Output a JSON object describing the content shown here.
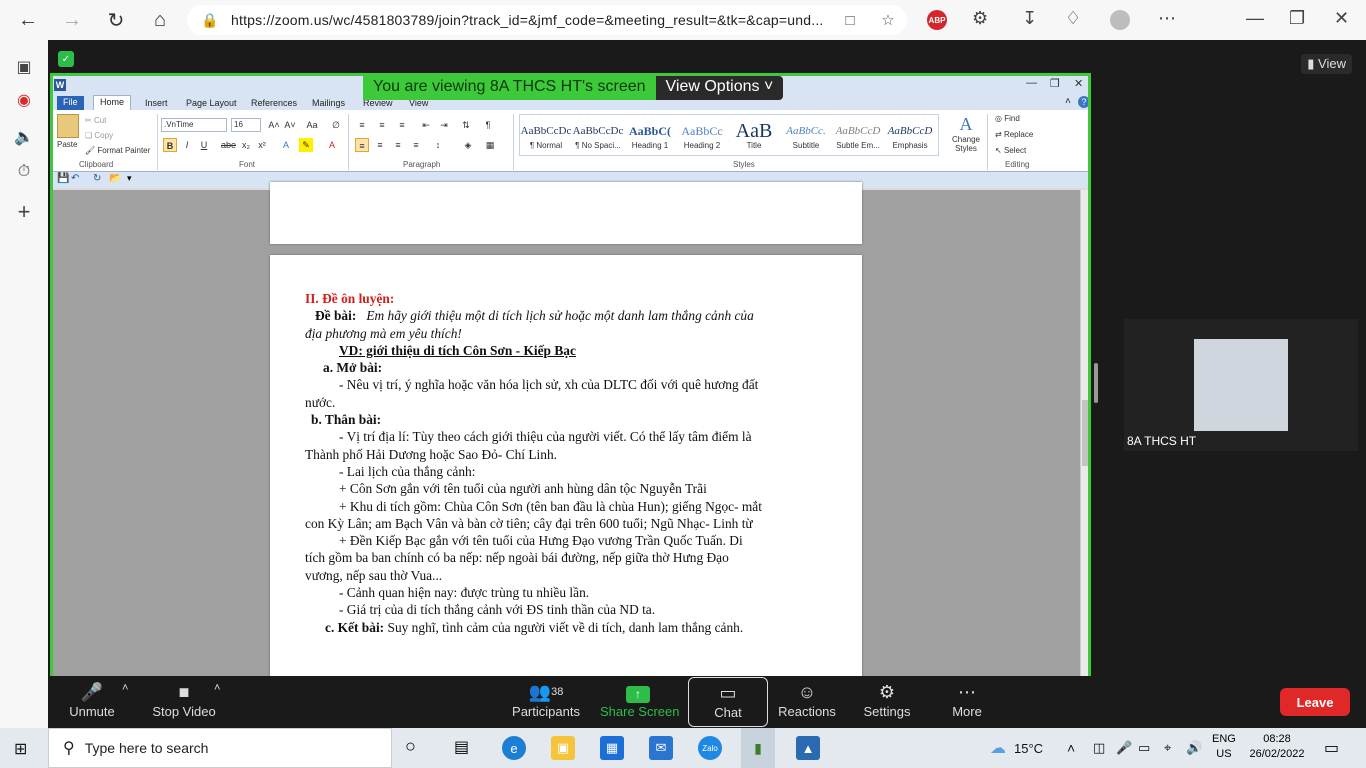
{
  "browser": {
    "url": "https://zoom.us/wc/4581803789/join?track_id=&jmf_code=&meeting_result=&tk=&cap=und...",
    "abp_label": "ABP"
  },
  "zoom": {
    "banner_text": "You are viewing 8A THCS HT's screen",
    "view_options": "View Options",
    "view_label": "View",
    "participant_name": "8A THCS HT"
  },
  "word": {
    "tabs": [
      "File",
      "Home",
      "Insert",
      "Page Layout",
      "References",
      "Mailings",
      "Review",
      "View"
    ],
    "clipboard": {
      "paste": "Paste",
      "cut": "Cut",
      "copy": "Copy",
      "format_painter": "Format Painter",
      "label": "Clipboard"
    },
    "font": {
      "name": ".VnTime",
      "size": "16",
      "label": "Font"
    },
    "paragraph_label": "Paragraph",
    "styles": [
      {
        "sample": "AaBbCcDc",
        "name": "¶ Normal"
      },
      {
        "sample": "AaBbCcDc",
        "name": "¶ No Spaci..."
      },
      {
        "sample": "AaBbC(",
        "name": "Heading 1"
      },
      {
        "sample": "AaBbCc",
        "name": "Heading 2"
      },
      {
        "sample": "AaB",
        "name": "Title"
      },
      {
        "sample": "AaBbCc.",
        "name": "Subtitle"
      },
      {
        "sample": "AaBbCcD",
        "name": "Subtle Em..."
      },
      {
        "sample": "AaBbCcD",
        "name": "Emphasis"
      }
    ],
    "styles_label": "Styles",
    "change_styles": "Change Styles",
    "editing": {
      "find": "Find",
      "replace": "Replace",
      "select": "Select",
      "label": "Editing"
    }
  },
  "document": {
    "lines": [
      "II. Đề ôn luyện:",
      "Đề bài:",
      "Em hãy giới thiệu một di tích lịch sử hoặc một danh lam thắng cảnh của",
      "địa phương mà em yêu thích!",
      "VD: giới thiệu di tích Côn Sơn - Kiếp Bạc",
      "a. Mở bài:",
      "- Nêu vị trí, ý nghĩa hoặc văn hóa lịch sử, xh của DLTC đối với quê hương đất",
      "nước.",
      "b.  Thân bài:",
      "- Vị trí địa lí: Tùy theo cách giới thiệu của người viết. Có thể lấy tâm điểm là",
      "Thành phố Hải Dương hoặc Sao Đỏ- Chí Linh.",
      "- Lai lịch của thắng cảnh:",
      "+ Côn Sơn gắn với tên tuổi của người anh hùng dân tộc Nguyễn Trãi",
      "+ Khu di tích gồm: Chùa Côn Sơn (tên ban đầu là chùa Hun); giếng Ngọc- mắt",
      "con Kỳ Lân; am Bạch Vân và bàn cờ tiên; cây đại trên 600 tuổi; Ngũ Nhạc- Linh từ",
      "+ Đền Kiếp Bạc gắn với tên tuổi của Hưng Đạo vương Trần Quốc Tuấn. Di",
      "tích gồm ba ban chính có ba nếp: nếp ngoài bái đường, nếp giữa thờ Hưng Đạo",
      "vương, nếp sau thờ Vua...",
      "- Cảnh quan hiện nay: được trùng tu nhiều lần.",
      "- Giá trị của di tích thắng cảnh với ĐS tinh thần của ND ta.",
      "c. Kết bài:",
      "Suy nghĩ, tình cảm của người viết về di tích, danh lam thắng cảnh."
    ]
  },
  "toolbar": {
    "unmute": "Unmute",
    "stop_video": "Stop Video",
    "participants": "Participants",
    "participants_count": "38",
    "share_screen": "Share Screen",
    "chat": "Chat",
    "reactions": "Reactions",
    "settings": "Settings",
    "more": "More",
    "leave": "Leave"
  },
  "taskbar": {
    "search_placeholder": "Type here to search",
    "temperature": "15°C",
    "lang_top": "ENG",
    "lang_bottom": "US",
    "time": "08:28",
    "date": "26/02/2022",
    "zalo": "Zalo"
  }
}
